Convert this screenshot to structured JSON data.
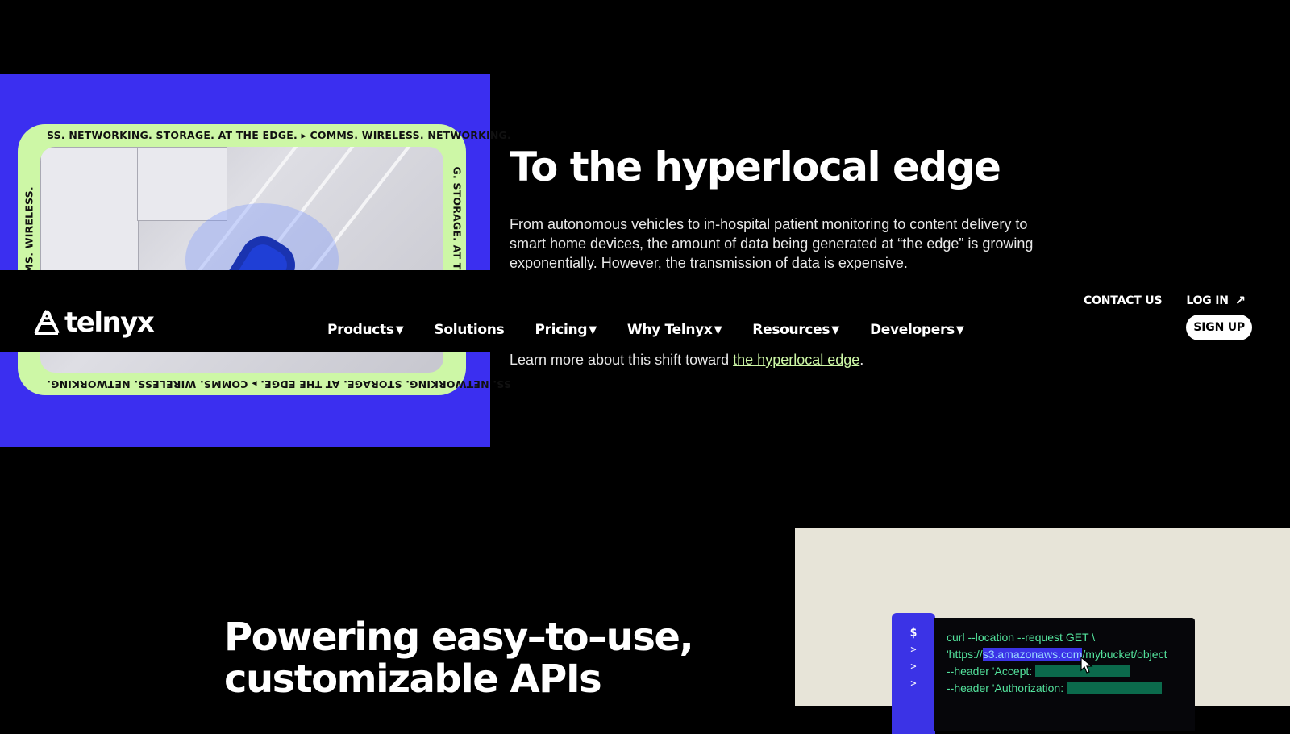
{
  "hero": {
    "marquee": {
      "top": "SS. NETWORKING. STORAGE. AT THE EDGE. ▸ COMMS. WIRELESS. NETWORKING.",
      "right": "G. STORAGE. AT THE EDGE.",
      "left": "EDGE. ▸ COMMS. WIRELESS.",
      "bottom": "SS. NETWORKING. STORAGE. AT THE EDGE. ▸ COMMS. WIRELESS. NETWORKING."
    },
    "title": "To the hyperlocal edge",
    "body": "From autonomous vehicles to in-hospital patient monitoring to content delivery to smart home devices, the amount of data being generated at “the edge” is growing exponentially. However, the transmission of data is expensive.",
    "more_prefix": "Learn more about this shift toward ",
    "more_link": "the hyperlocal edge",
    "more_suffix": "."
  },
  "nav": {
    "logo_text": "telnyx",
    "items": [
      {
        "label": "Products",
        "caret": "▼"
      },
      {
        "label": "Solutions",
        "caret": ""
      },
      {
        "label": "Pricing",
        "caret": "▼"
      },
      {
        "label": "Why Telnyx",
        "caret": "▼"
      },
      {
        "label": "Resources",
        "caret": "▼"
      },
      {
        "label": "Developers",
        "caret": "▼"
      }
    ],
    "contact": "CONTACT US",
    "login": "LOG IN",
    "login_arrow": "↗",
    "signup": "SIGN UP"
  },
  "apis": {
    "title_line1": "Powering easy–to–use,",
    "title_line2": "customizable APIs",
    "gutter": [
      "$",
      ">",
      ">",
      ">"
    ],
    "code": {
      "line1": "curl --location --request GET \\",
      "line2_pre": "'https://",
      "line2_hl": "s3.amazonaws.com",
      "line2_post": "/mybucket/object",
      "line3": "--header 'Accept:",
      "line4": "--header 'Authorization:"
    }
  },
  "colors": {
    "hero_bg": "#3b2ff0",
    "marquee": "#cdf7a6",
    "code_green": "#53e29c",
    "panel_bg": "#e7e4d8"
  }
}
